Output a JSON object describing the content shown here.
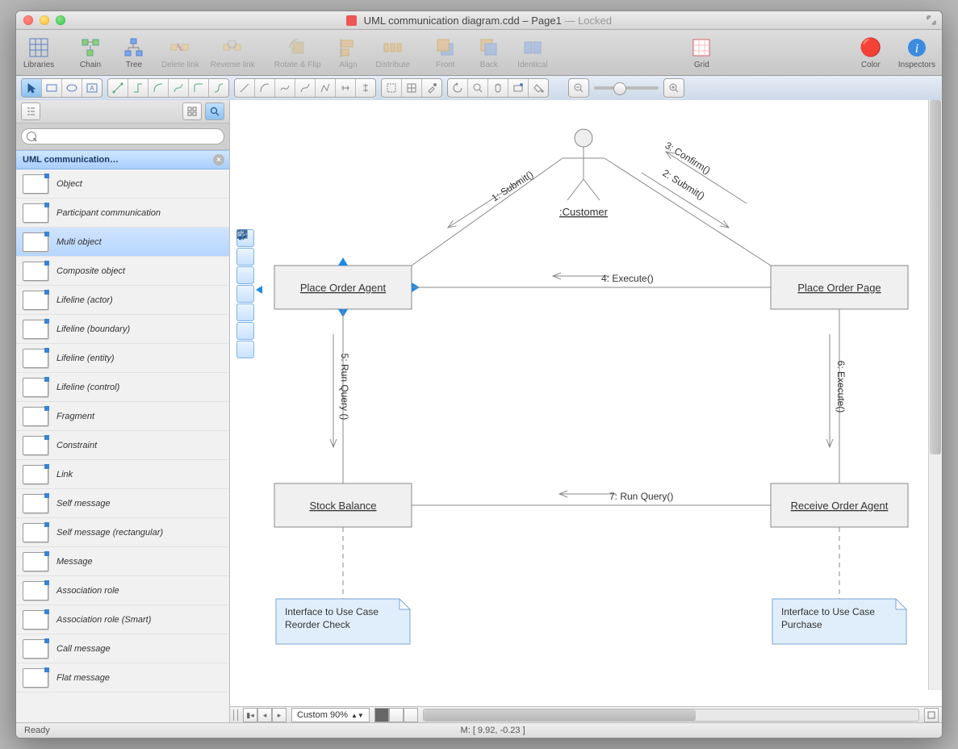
{
  "window": {
    "doc_name": "UML communication diagram.cdd",
    "page": "Page1",
    "locked_suffix": "— Locked"
  },
  "toolbar": {
    "libraries": "Libraries",
    "chain": "Chain",
    "tree": "Tree",
    "delete_link": "Delete link",
    "reverse_link": "Reverse link",
    "rotate_flip": "Rotate & Flip",
    "align": "Align",
    "distribute": "Distribute",
    "front": "Front",
    "back": "Back",
    "identical": "Identical",
    "grid": "Grid",
    "color": "Color",
    "inspectors": "Inspectors"
  },
  "library": {
    "header": "UML communication…",
    "items": [
      "Object",
      "Participant communication",
      "Multi object",
      "Composite object",
      "Lifeline (actor)",
      "Lifeline (boundary)",
      "Lifeline (entity)",
      "Lifeline (control)",
      "Fragment",
      "Constraint",
      "Link",
      "Self message",
      "Self message (rectangular)",
      "Message",
      "Association role",
      "Association role (Smart)",
      "Call message",
      "Flat message"
    ],
    "selected_index": 2
  },
  "search": {
    "placeholder": ""
  },
  "diagram": {
    "actor": ":Customer",
    "objects": {
      "place_order_agent": "Place Order Agent",
      "place_order_page": "Place Order Page",
      "stock_balance": "Stock Balance",
      "receive_order_agent": "Receive Order Agent"
    },
    "messages": {
      "m1": "1: Submit()",
      "m2": "2: Submit()",
      "m3": "3: Confirm()",
      "m4": "4: Execute()",
      "m5": "5: Run Query ()",
      "m6": "6: Execute()",
      "m7": "7: Run Query()"
    },
    "notes": {
      "n1_l1": "Interface to Use Case",
      "n1_l2": "Reorder Check",
      "n2_l1": "Interface to Use Case",
      "n2_l2": "Purchase"
    }
  },
  "bottom": {
    "zoom": "Custom 90%"
  },
  "status": {
    "ready": "Ready",
    "coords": "M: [ 9.92, -0.23 ]"
  }
}
